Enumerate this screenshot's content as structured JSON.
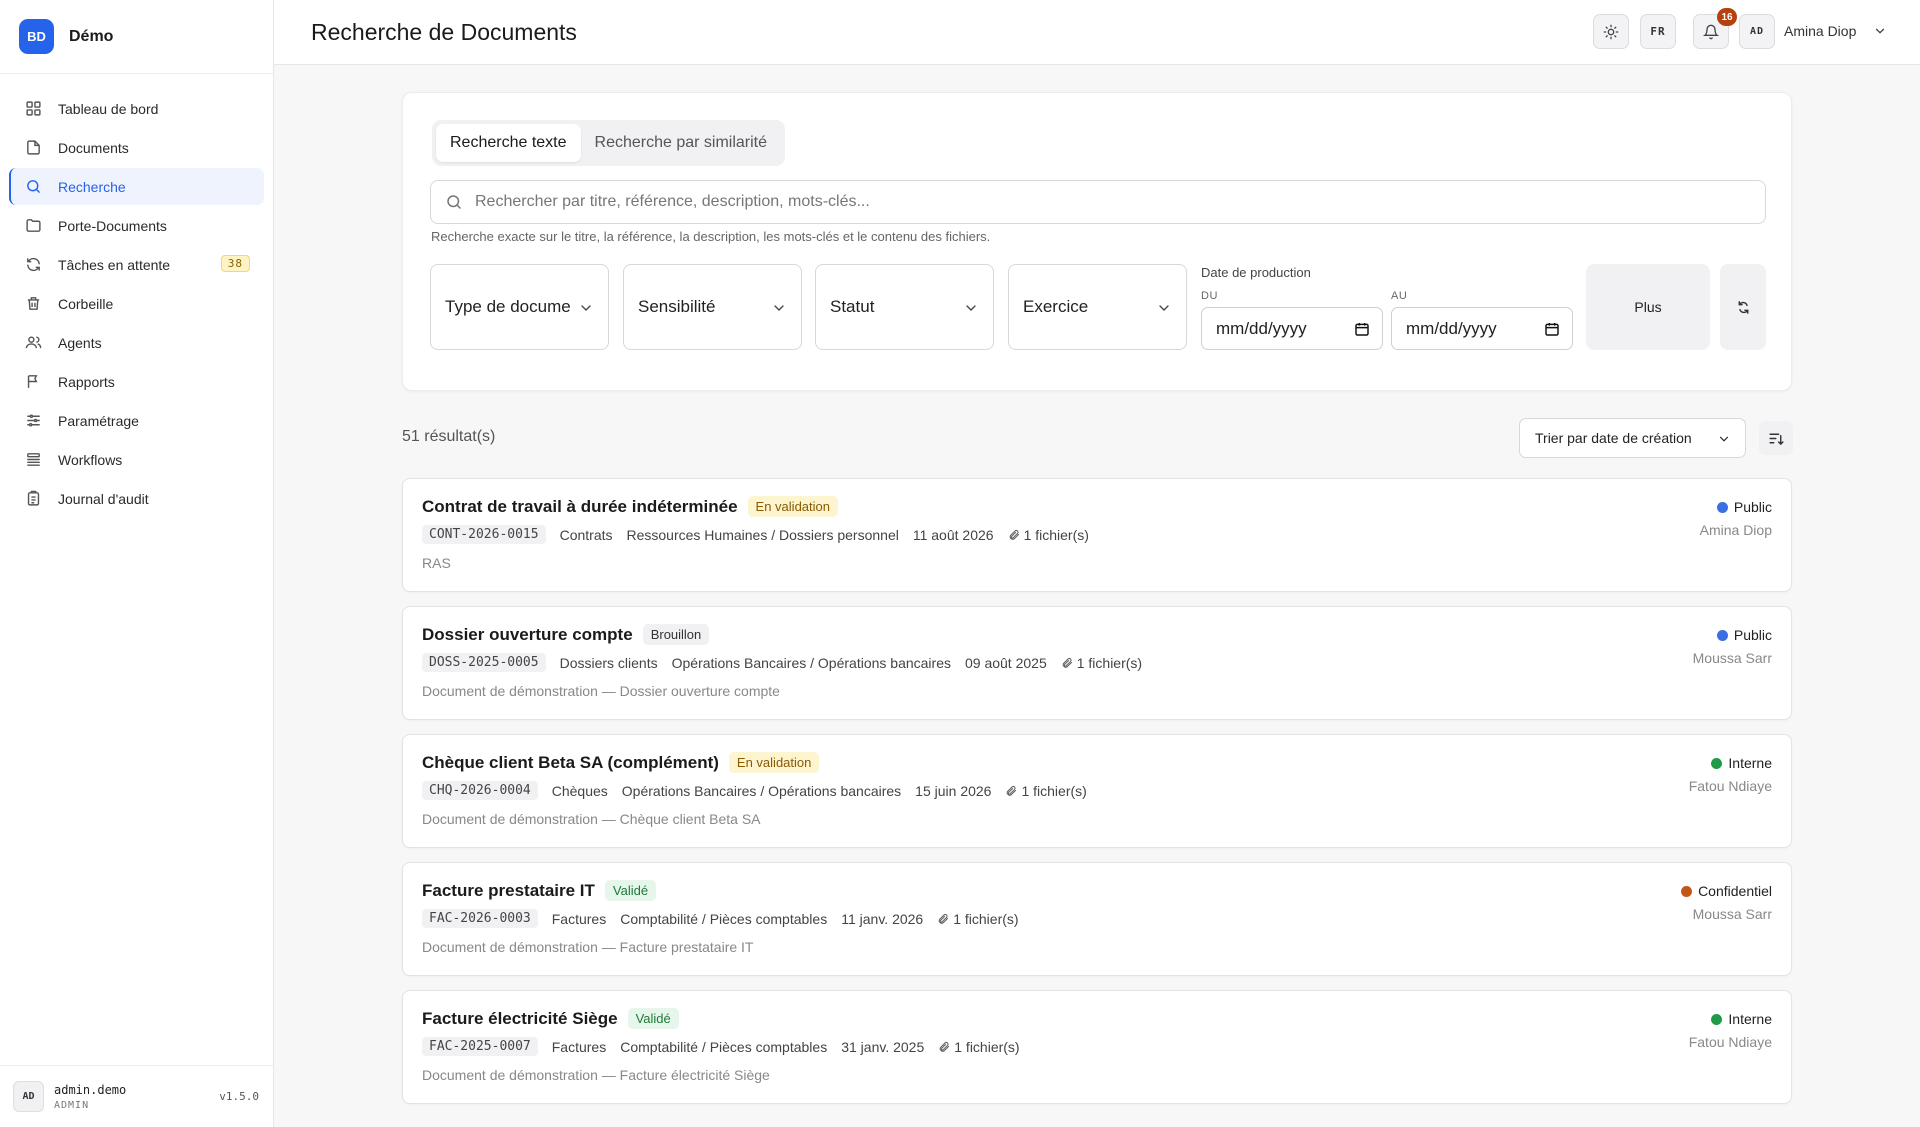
{
  "brand": {
    "logo": "BD",
    "name": "Démo"
  },
  "sidebar": {
    "items": [
      {
        "label": "Tableau de bord",
        "icon": "grid-icon"
      },
      {
        "label": "Documents",
        "icon": "file-icon"
      },
      {
        "label": "Recherche",
        "icon": "search-icon",
        "active": true
      },
      {
        "label": "Porte-Documents",
        "icon": "folder-icon"
      },
      {
        "label": "Tâches en attente",
        "icon": "refresh-icon",
        "badge": "38"
      },
      {
        "label": "Corbeille",
        "icon": "trash-icon"
      },
      {
        "label": "Agents",
        "icon": "users-icon"
      },
      {
        "label": "Rapports",
        "icon": "flag-icon"
      },
      {
        "label": "Paramétrage",
        "icon": "sliders-icon"
      },
      {
        "label": "Workflows",
        "icon": "layers-icon"
      },
      {
        "label": "Journal d'audit",
        "icon": "clipboard-icon"
      }
    ],
    "footer": {
      "avatar": "AD",
      "username": "admin.demo",
      "role": "ADMIN",
      "version": "v1.5.0"
    }
  },
  "header": {
    "title": "Recherche de Documents",
    "lang": "FR",
    "notifications": "16",
    "user_initials": "AD",
    "user_name": "Amina Diop"
  },
  "search": {
    "tabs": [
      "Recherche texte",
      "Recherche par similarité"
    ],
    "placeholder": "Rechercher par titre, référence, description, mots-clés...",
    "hint": "Recherche exacte sur le titre, la référence, la description, les mots-clés et le contenu des fichiers.",
    "filters": [
      "Type de document",
      "Sensibilité",
      "Statut",
      "Exercice"
    ],
    "date_label": "Date de production",
    "date_from_label": "DU",
    "date_to_label": "AU",
    "date_placeholder": "mm/dd/yyyy",
    "more_label": "Plus"
  },
  "results": {
    "count": "51 résultat(s)",
    "sort_label": "Trier par date de création",
    "items": [
      {
        "title": "Contrat de travail à durée indéterminée",
        "status": "En validation",
        "ref": "CONT-2026-0015",
        "type": "Contrats",
        "path": "Ressources Humaines / Dossiers personnel",
        "date": "11 août 2026",
        "files": "1 fichier(s)",
        "desc": "RAS",
        "sensitivity": "Public",
        "owner": "Amina Diop"
      },
      {
        "title": "Dossier ouverture compte",
        "status": "Brouillon",
        "ref": "DOSS-2025-0005",
        "type": "Dossiers clients",
        "path": "Opérations Bancaires / Opérations bancaires",
        "date": "09 août 2025",
        "files": "1 fichier(s)",
        "desc": "Document de démonstration — Dossier ouverture compte",
        "sensitivity": "Public",
        "owner": "Moussa Sarr"
      },
      {
        "title": "Chèque client Beta SA (complément)",
        "status": "En validation",
        "ref": "CHQ-2026-0004",
        "type": "Chèques",
        "path": "Opérations Bancaires / Opérations bancaires",
        "date": "15 juin 2026",
        "files": "1 fichier(s)",
        "desc": "Document de démonstration — Chèque client Beta SA",
        "sensitivity": "Interne",
        "owner": "Fatou Ndiaye"
      },
      {
        "title": "Facture prestataire IT",
        "status": "Validé",
        "ref": "FAC-2026-0003",
        "type": "Factures",
        "path": "Comptabilité / Pièces comptables",
        "date": "11 janv. 2026",
        "files": "1 fichier(s)",
        "desc": "Document de démonstration — Facture prestataire IT",
        "sensitivity": "Confidentiel",
        "owner": "Moussa Sarr"
      },
      {
        "title": "Facture électricité Siège",
        "status": "Validé",
        "ref": "FAC-2025-0007",
        "type": "Factures",
        "path": "Comptabilité / Pièces comptables",
        "date": "31 janv. 2025",
        "files": "1 fichier(s)",
        "desc": "Document de démonstration — Facture électricité Siège",
        "sensitivity": "Interne",
        "owner": "Fatou Ndiaye"
      }
    ]
  },
  "colors": {
    "accent": "#2563eb",
    "public": "#3b6fe0",
    "interne": "#1f9a4a",
    "confidentiel": "#c2561a"
  }
}
